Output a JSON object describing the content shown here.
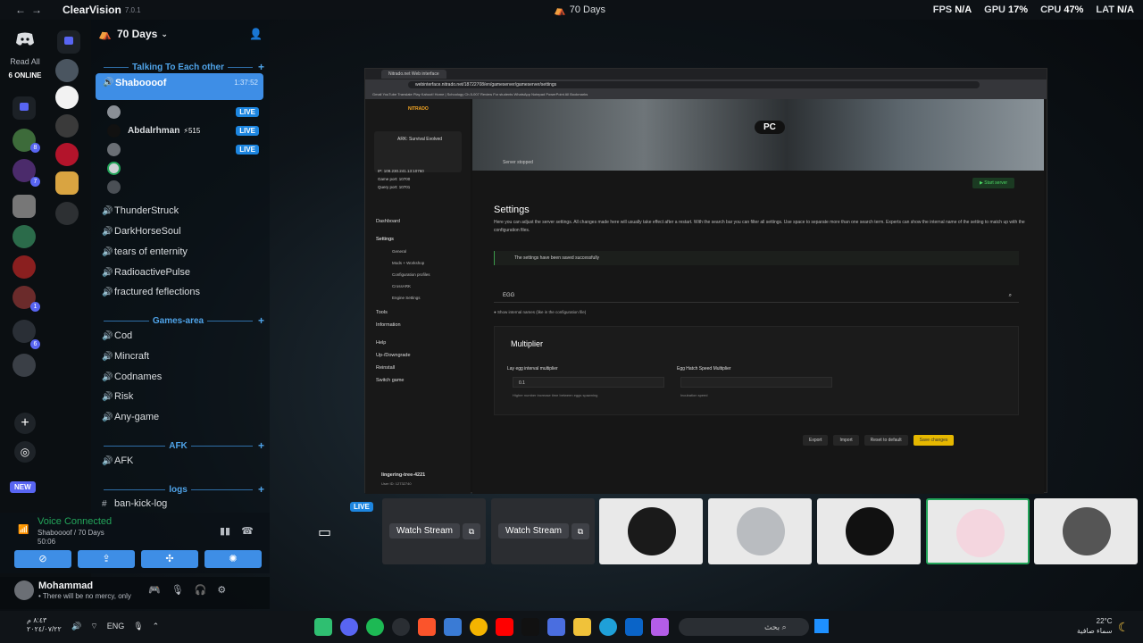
{
  "titlebar": {
    "back": "←",
    "forward": "→",
    "app_name": "ClearVision",
    "version": "7.0.1",
    "center_title": "70 Days",
    "stats": [
      {
        "k": "FPS",
        "v": "N/A"
      },
      {
        "k": "GPU",
        "v": "17%"
      },
      {
        "k": "CPU",
        "v": "47%"
      },
      {
        "k": "LAT",
        "v": "N/A"
      }
    ]
  },
  "rail": {
    "read_all": "Read All",
    "online": "6 ONLINE",
    "new_label": "NEW",
    "badges": [
      "8",
      "7",
      "1",
      "6",
      "1"
    ]
  },
  "server": {
    "name": "70 Days",
    "categories": {
      "talking": "Talking To Each other",
      "games": "Games-area",
      "afk": "AFK",
      "logs": "logs"
    },
    "selected_channel": {
      "name": "Shaboooof",
      "time": "1:37:52"
    },
    "members": [
      {
        "name": "",
        "live": "LIVE"
      },
      {
        "name": "Abdalrhman",
        "tag": "515",
        "live": "LIVE"
      },
      {
        "name": "",
        "live": "LIVE"
      },
      {
        "name": "",
        "live": ""
      },
      {
        "name": "",
        "live": ""
      }
    ],
    "talking_channels": [
      "ThunderStruck",
      "DarkHorseSoul",
      "tears of enternity",
      "RadioactivePulse",
      "fractured feflections"
    ],
    "game_channels": [
      "Cod",
      "Mincraft",
      "Codnames",
      "Risk",
      "Any-game"
    ],
    "afk_channel": "AFK",
    "log_channel": "ban-kick-log"
  },
  "voice": {
    "status": "Voice Connected",
    "sub": "Shaboooof / 70 Days",
    "time": "50:06"
  },
  "user": {
    "name": "Mohammad",
    "status": "There will be no mercy, only"
  },
  "stream": {
    "tab_title": "Nitrado.net Web interface",
    "url": "webinterface.nitrado.net/18722708/en/gameserver/gameserver/settings",
    "bookmarks": "Gmail  YouTube  Translate  Play Kahoot!  Home | Schoology  Ch.5-007 Review  For students  WhatsApp  Notepad  PowerPoint  All Bookmarks",
    "logo": "NITRADO",
    "game_name": "ARK: Survival Evolved",
    "ip": "IP: 109.230.241.13:10760",
    "game_port": "Game port: 10700",
    "query_port": "Query port: 10701",
    "nav": {
      "dashboard": "Dashboard",
      "settings": "Settings",
      "general": "General",
      "mods": "Mods + Workshop",
      "config": "Configuration profiles",
      "crossark": "CrossARK",
      "engine": "Engine Settings",
      "tools": "Tools",
      "information": "Information",
      "help": "Help",
      "updown": "Up-/Downgrade",
      "reinstall": "Reinstall",
      "switch": "Switch game"
    },
    "username": "lingering-tree-4221",
    "user_id": "User ID: 12732740",
    "banner_badge": "PC",
    "server_status": "Server stopped",
    "start_btn": "Start server",
    "settings_title": "Settings",
    "settings_desc": "Here you can adjust the server settings. All changes made here will usually take effect after a restart. With the search bar you can filter all settings. Use space to separate more than one search term. Experts can show the internal name of the setting to match up with the configuration files.",
    "saved_msg": "The settings have been saved successfully",
    "search_value": "EGG",
    "toggle_label": "Show internal names (like in the configuration file)",
    "multiplier_title": "Multiplier",
    "field1_label": "Lay egg interval multiplier",
    "field1_value": "0.1",
    "field1_help": "Higher number increase time between eggs spawning",
    "field2_label": "Egg Hatch Speed Multiplier",
    "field2_value": "",
    "field2_help": "Incubation speed",
    "export": "Export",
    "import": "Import",
    "reset": "Reset to default",
    "save": "Save changes"
  },
  "tiles": {
    "live": "LIVE",
    "watch1": "Watch Stream",
    "watch2": "Watch Stream"
  },
  "taskbar": {
    "time": "٨:٤٣ م",
    "date": "٢٠٢٤/٠٧/٢٢",
    "lang": "ENG",
    "search": "بحث",
    "temp": "22°C",
    "weather": "سماء صافية"
  },
  "colors": {
    "accent": "#3e8ee6",
    "live": "#1d86e0",
    "voice_green": "#23a55a",
    "save_yellow": "#e6b800"
  }
}
